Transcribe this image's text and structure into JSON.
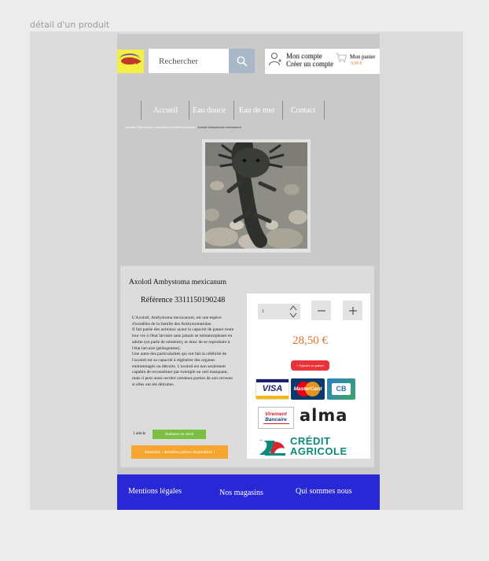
{
  "frame": {
    "title": "détail d'un produit"
  },
  "header": {
    "search_placeholder": "Rechercher",
    "account": {
      "line1": "Mon compte",
      "line2": "Créer un compte"
    },
    "cart": {
      "label": "Mon panier",
      "total": "0,00 €"
    }
  },
  "nav": {
    "items": [
      "Accueil",
      "Eau douce",
      "Eau de mer",
      "Contact"
    ]
  },
  "breadcrumb": {
    "path": "Accueil / Eau douce / crevettes invertébrés tortues / ",
    "current": "Axolotl Ambystoma mexicanum"
  },
  "product": {
    "title": "Axolotl Ambystoma mexicanum",
    "reference": "Référence 3311150190248",
    "description": [
      "L'Axolotl, Ambystoma mexicanum, est une espèce d'urodèles de la famille des Ambystomatidae.",
      "Il fait partie des animaux ayant la capacité de passer toute leur vie à l'état larvaire sans jamais se métamorphoser en adulte (on parle de néoténie), et donc de se reproduire à l'état larvaire (pédogenèse).",
      "Une autre des particularités qui ont fait la célébrité de l'axolotl est sa capacité à régénérer des organes endommagés ou détruits. L'axolotl est non seulement capable de reconstituer par exemple un oeil manquant, mais il peut aussi recréer certaines parties de son cerveau si elles ont été détruites."
    ],
    "quantity_label": "1 article",
    "stock": "Animaux en stock",
    "warning": "Attention : dernières pièces disponibles !",
    "qty_value": "1",
    "price": "28,50 €",
    "add_to_cart": "+ Ajouter au panier"
  },
  "payments": {
    "visa": "VISA",
    "mastercard": "MasterCard",
    "cb": "CB",
    "virement_line1": "Virement",
    "virement_line2": "Bancaire",
    "alma": "alma",
    "ca_line1": "CRÉDIT",
    "ca_line2": "AGRICOLE"
  },
  "footer": {
    "links": [
      "Mentions légales",
      "Nos magasins",
      "Qui sommes nous"
    ]
  },
  "colors": {
    "accent_price": "#e8702a",
    "footer_bg": "#2828d6",
    "stock_green": "#7bc043",
    "warning_orange": "#f7a531",
    "add_red": "#e8333a"
  }
}
